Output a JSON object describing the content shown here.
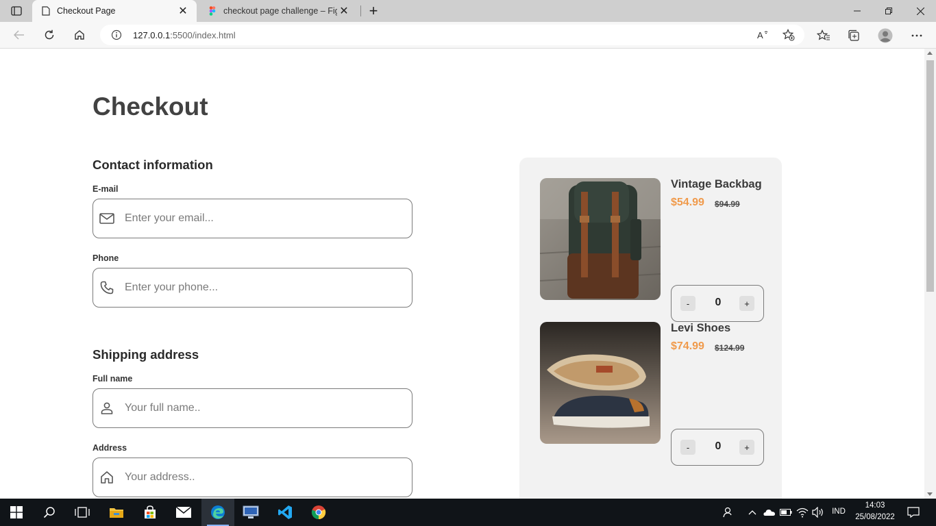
{
  "browser": {
    "tabs": [
      {
        "title": "Checkout Page",
        "active": true
      },
      {
        "title": "checkout page challenge – Figma",
        "active": false
      }
    ],
    "url_host": "127.0.0.1",
    "url_rest": ":5500/index.html"
  },
  "page": {
    "title": "Checkout",
    "contact": {
      "heading": "Contact information",
      "email_label": "E-mail",
      "email_placeholder": "Enter your email...",
      "phone_label": "Phone",
      "phone_placeholder": "Enter your phone..."
    },
    "shipping": {
      "heading": "Shipping address",
      "fullname_label": "Full name",
      "fullname_placeholder": "Your full name..",
      "address_label": "Address",
      "address_placeholder": "Your address.."
    }
  },
  "cart": {
    "items": [
      {
        "name": "Vintage Backbag",
        "price": "$54.99",
        "old_price": "$94.99",
        "qty": "0",
        "minus": "-",
        "plus": "+"
      },
      {
        "name": "Levi Shoes",
        "price": "$74.99",
        "old_price": "$124.99",
        "qty": "0",
        "minus": "-",
        "plus": "+"
      }
    ]
  },
  "colors": {
    "accent_price": "#f09a4b",
    "panel_bg": "#f2f2f2",
    "title_text": "#424242"
  },
  "taskbar": {
    "lang": "IND",
    "time": "14:03",
    "date": "25/08/2022"
  }
}
